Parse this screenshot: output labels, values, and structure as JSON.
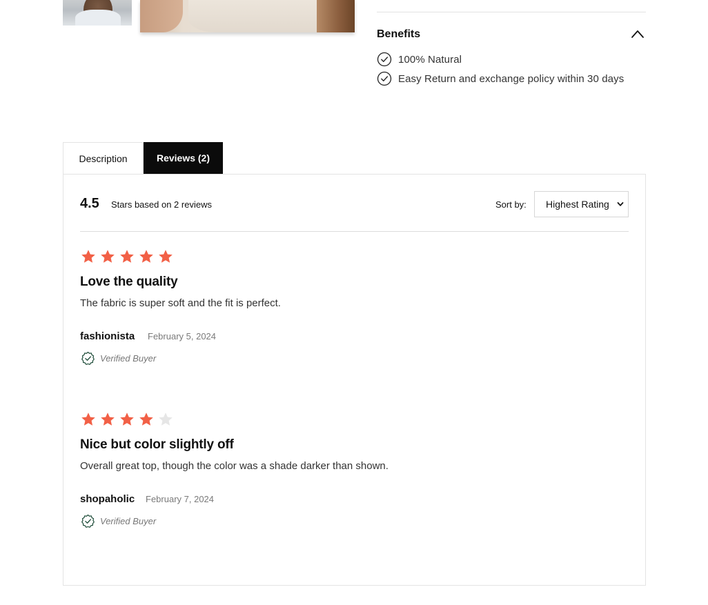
{
  "benefits": {
    "title": "Benefits",
    "items": [
      "100% Natural",
      "Easy Return and exchange policy within 30 days"
    ]
  },
  "tabs": [
    {
      "label": "Description",
      "active": false
    },
    {
      "label": "Reviews (2)",
      "active": true
    }
  ],
  "summary": {
    "score": "4.5",
    "text": "Stars based on 2 reviews",
    "sort_label": "Sort by:",
    "sort_value": "Highest Rating"
  },
  "reviews": [
    {
      "rating": 5,
      "title": "Love the quality",
      "body": "The fabric is super soft and the fit is perfect.",
      "author": "fashionista",
      "date": "February 5, 2024",
      "verified": "Verified Buyer"
    },
    {
      "rating": 4,
      "title": "Nice but color slightly off",
      "body": "Overall great top, though the color was a shade darker than shown.",
      "author": "shopaholic",
      "date": "February 7, 2024",
      "verified": "Verified Buyer"
    }
  ],
  "colors": {
    "star_filled": "#f26046",
    "star_empty": "#e6e6e6",
    "active_tab_bg": "#0b0b0b",
    "verified_icon": "#1f4d3a"
  }
}
